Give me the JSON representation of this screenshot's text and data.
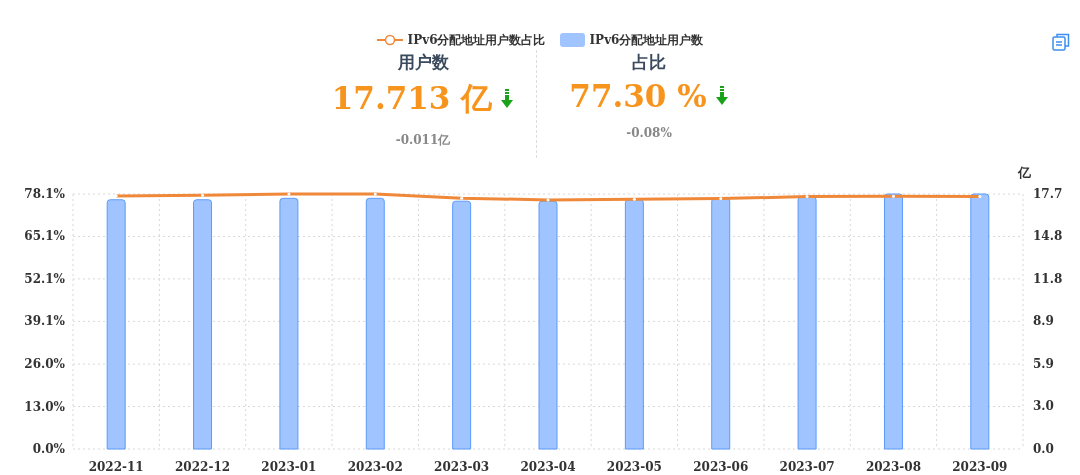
{
  "stats": [
    {
      "title": "用户数",
      "value": "17.713 亿",
      "decreased": true,
      "change": "-0.011亿"
    },
    {
      "title": "占比",
      "value": "77.30 %",
      "decreased": true,
      "change": "-0.08%"
    }
  ],
  "chart_data": {
    "type": "bar",
    "grid": true,
    "categories": [
      "2022-11",
      "2022-12",
      "2023-01",
      "2023-02",
      "2023-03",
      "2023-04",
      "2023-05",
      "2023-06",
      "2023-07",
      "2023-08",
      "2023-09"
    ],
    "series": [
      {
        "name": "IPv6分配地址用户数占比",
        "type": "line",
        "color": "#f0883a",
        "values": [
          77.5,
          77.7,
          78.1,
          78.1,
          76.8,
          76.3,
          76.5,
          76.7,
          77.3,
          77.4,
          77.3
        ]
      },
      {
        "name": "IPv6分配地址用户数",
        "type": "bar",
        "axis": "y2",
        "color": "#a0c4ff",
        "values": [
          17.3,
          17.3,
          17.4,
          17.4,
          17.2,
          17.2,
          17.3,
          17.4,
          17.5,
          17.7,
          17.7
        ]
      }
    ],
    "ylim": [
      0,
      78.1
    ],
    "yticks": [
      {
        "value": 0,
        "label": "0.0%"
      },
      {
        "value": 13.0,
        "label": "13.0%"
      },
      {
        "value": 26.0,
        "label": "26.0%"
      },
      {
        "value": 39.1,
        "label": "39.1%"
      },
      {
        "value": 52.1,
        "label": "52.1%"
      },
      {
        "value": 65.1,
        "label": "65.1%"
      },
      {
        "value": 78.1,
        "label": "78.1%"
      }
    ],
    "y2label": "亿",
    "y2lim": [
      0,
      17.7
    ],
    "y2ticks": [
      {
        "value": 0,
        "label": "0.0"
      },
      {
        "value": 3.0,
        "label": "3.0"
      },
      {
        "value": 5.9,
        "label": "5.9"
      },
      {
        "value": 8.9,
        "label": "8.9"
      },
      {
        "value": 11.8,
        "label": "11.8"
      },
      {
        "value": 14.8,
        "label": "14.8"
      },
      {
        "value": 17.7,
        "label": "17.7"
      }
    ]
  }
}
